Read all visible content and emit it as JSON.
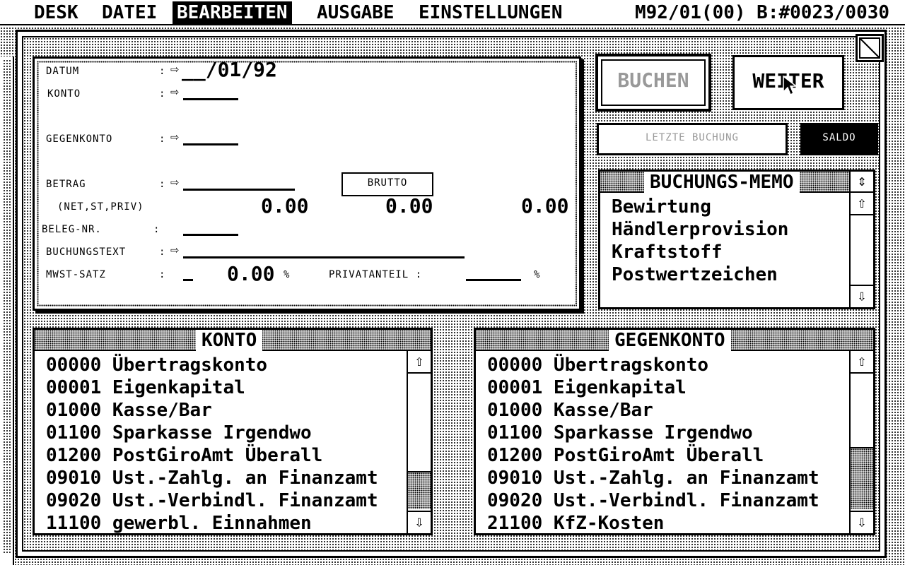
{
  "menubar": {
    "items": [
      "DESK",
      "DATEI",
      "BEARBEITEN",
      "AUSGABE",
      "EINSTELLUNGEN"
    ],
    "active": "BEARBEITEN",
    "status": "M92/01(00) B:#0023/0030"
  },
  "form": {
    "datum_label": "DATUM",
    "datum_value": "__/01/92",
    "konto_label": "KONTO",
    "gegenkonto_label": "GEGENKONTO",
    "betrag_label": "BETRAG",
    "betrag_sub": "(NET,ST,PRIV)",
    "brutto_label": "BRUTTO",
    "net_value": "0.00",
    "st_value": "0.00",
    "priv_value": "0.00",
    "beleg_label": "BELEG-NR.",
    "buchungstext_label": "BUCHUNGSTEXT",
    "mwst_label": "MWST-SATZ",
    "mwst_value": "0.00",
    "percent_sign": "%",
    "privatanteil_label": "PRIVATANTEIL :",
    "colon": ":"
  },
  "buttons": {
    "buchen": "BUCHEN",
    "weiter": "WEITER",
    "letzte_buchung": "LETZTE BUCHUNG",
    "saldo": "SALDO"
  },
  "memo": {
    "title": "BUCHUNGS-MEMO",
    "items": [
      "Bewirtung",
      "Händlerprovision",
      "Kraftstoff",
      "Postwertzeichen"
    ]
  },
  "konto_list": {
    "title": "KONTO",
    "rows": [
      "00000 Übertragskonto",
      "00001 Eigenkapital",
      "01000 Kasse/Bar",
      "01100 Sparkasse Irgendwo",
      "01200 PostGiroAmt Überall",
      "09010 Ust.-Zahlg. an Finanzamt",
      "09020 Ust.-Verbindl. Finanzamt",
      "11100 gewerbl. Einnahmen"
    ]
  },
  "gegenkonto_list": {
    "title": "GEGENKONTO",
    "rows": [
      "00000 Übertragskonto",
      "00001 Eigenkapital",
      "01000 Kasse/Bar",
      "01100 Sparkasse Irgendwo",
      "01200 PostGiroAmt Überall",
      "09010 Ust.-Zahlg. an Finanzamt",
      "09020 Ust.-Verbindl. Finanzamt",
      "21100 KfZ-Kosten"
    ]
  },
  "icons": {
    "up": "⇧",
    "down": "⇩",
    "pointer": "⇨",
    "updown": "⇕"
  }
}
